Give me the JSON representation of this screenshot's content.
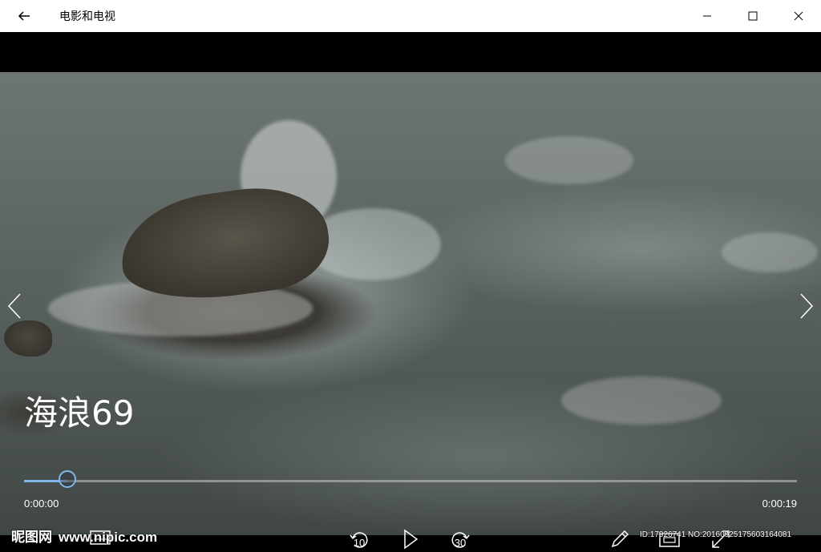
{
  "titlebar": {
    "app_title": "电影和电视",
    "back_icon": "back-arrow-icon",
    "minimize_icon": "minimize-icon",
    "maximize_icon": "maximize-icon",
    "close_icon": "close-icon"
  },
  "video": {
    "title": "海浪69",
    "progress_fraction": 0.056,
    "current_time": "0:00:00",
    "total_time": "0:00:19"
  },
  "controls": {
    "skip_back_seconds": "10",
    "skip_forward_seconds": "30",
    "icons": [
      "skip-back-icon",
      "play-icon",
      "skip-forward-icon",
      "pencil-icon",
      "aspect-ratio-icon",
      "fullscreen-icon",
      "caption-icon"
    ]
  },
  "navigation": {
    "prev_icon": "chevron-left-icon",
    "next_icon": "chevron-right-icon"
  },
  "watermark": {
    "brand": "昵图网",
    "url": "www.nipic.com",
    "id_text": "ID:17926741 NO:20160925175603164081"
  },
  "colors": {
    "accent": "#7fb8e8",
    "titlebar_bg": "#ffffff",
    "text_light": "#ffffff"
  }
}
